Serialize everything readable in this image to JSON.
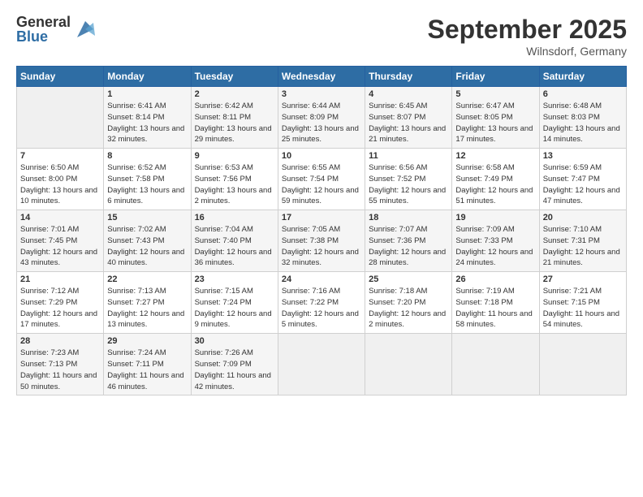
{
  "logo": {
    "general": "General",
    "blue": "Blue"
  },
  "header": {
    "month": "September 2025",
    "location": "Wilnsdorf, Germany"
  },
  "days_of_week": [
    "Sunday",
    "Monday",
    "Tuesday",
    "Wednesday",
    "Thursday",
    "Friday",
    "Saturday"
  ],
  "weeks": [
    [
      {
        "day": "",
        "sunrise": "",
        "sunset": "",
        "daylight": ""
      },
      {
        "day": "1",
        "sunrise": "Sunrise: 6:41 AM",
        "sunset": "Sunset: 8:14 PM",
        "daylight": "Daylight: 13 hours and 32 minutes."
      },
      {
        "day": "2",
        "sunrise": "Sunrise: 6:42 AM",
        "sunset": "Sunset: 8:11 PM",
        "daylight": "Daylight: 13 hours and 29 minutes."
      },
      {
        "day": "3",
        "sunrise": "Sunrise: 6:44 AM",
        "sunset": "Sunset: 8:09 PM",
        "daylight": "Daylight: 13 hours and 25 minutes."
      },
      {
        "day": "4",
        "sunrise": "Sunrise: 6:45 AM",
        "sunset": "Sunset: 8:07 PM",
        "daylight": "Daylight: 13 hours and 21 minutes."
      },
      {
        "day": "5",
        "sunrise": "Sunrise: 6:47 AM",
        "sunset": "Sunset: 8:05 PM",
        "daylight": "Daylight: 13 hours and 17 minutes."
      },
      {
        "day": "6",
        "sunrise": "Sunrise: 6:48 AM",
        "sunset": "Sunset: 8:03 PM",
        "daylight": "Daylight: 13 hours and 14 minutes."
      }
    ],
    [
      {
        "day": "7",
        "sunrise": "Sunrise: 6:50 AM",
        "sunset": "Sunset: 8:00 PM",
        "daylight": "Daylight: 13 hours and 10 minutes."
      },
      {
        "day": "8",
        "sunrise": "Sunrise: 6:52 AM",
        "sunset": "Sunset: 7:58 PM",
        "daylight": "Daylight: 13 hours and 6 minutes."
      },
      {
        "day": "9",
        "sunrise": "Sunrise: 6:53 AM",
        "sunset": "Sunset: 7:56 PM",
        "daylight": "Daylight: 13 hours and 2 minutes."
      },
      {
        "day": "10",
        "sunrise": "Sunrise: 6:55 AM",
        "sunset": "Sunset: 7:54 PM",
        "daylight": "Daylight: 12 hours and 59 minutes."
      },
      {
        "day": "11",
        "sunrise": "Sunrise: 6:56 AM",
        "sunset": "Sunset: 7:52 PM",
        "daylight": "Daylight: 12 hours and 55 minutes."
      },
      {
        "day": "12",
        "sunrise": "Sunrise: 6:58 AM",
        "sunset": "Sunset: 7:49 PM",
        "daylight": "Daylight: 12 hours and 51 minutes."
      },
      {
        "day": "13",
        "sunrise": "Sunrise: 6:59 AM",
        "sunset": "Sunset: 7:47 PM",
        "daylight": "Daylight: 12 hours and 47 minutes."
      }
    ],
    [
      {
        "day": "14",
        "sunrise": "Sunrise: 7:01 AM",
        "sunset": "Sunset: 7:45 PM",
        "daylight": "Daylight: 12 hours and 43 minutes."
      },
      {
        "day": "15",
        "sunrise": "Sunrise: 7:02 AM",
        "sunset": "Sunset: 7:43 PM",
        "daylight": "Daylight: 12 hours and 40 minutes."
      },
      {
        "day": "16",
        "sunrise": "Sunrise: 7:04 AM",
        "sunset": "Sunset: 7:40 PM",
        "daylight": "Daylight: 12 hours and 36 minutes."
      },
      {
        "day": "17",
        "sunrise": "Sunrise: 7:05 AM",
        "sunset": "Sunset: 7:38 PM",
        "daylight": "Daylight: 12 hours and 32 minutes."
      },
      {
        "day": "18",
        "sunrise": "Sunrise: 7:07 AM",
        "sunset": "Sunset: 7:36 PM",
        "daylight": "Daylight: 12 hours and 28 minutes."
      },
      {
        "day": "19",
        "sunrise": "Sunrise: 7:09 AM",
        "sunset": "Sunset: 7:33 PM",
        "daylight": "Daylight: 12 hours and 24 minutes."
      },
      {
        "day": "20",
        "sunrise": "Sunrise: 7:10 AM",
        "sunset": "Sunset: 7:31 PM",
        "daylight": "Daylight: 12 hours and 21 minutes."
      }
    ],
    [
      {
        "day": "21",
        "sunrise": "Sunrise: 7:12 AM",
        "sunset": "Sunset: 7:29 PM",
        "daylight": "Daylight: 12 hours and 17 minutes."
      },
      {
        "day": "22",
        "sunrise": "Sunrise: 7:13 AM",
        "sunset": "Sunset: 7:27 PM",
        "daylight": "Daylight: 12 hours and 13 minutes."
      },
      {
        "day": "23",
        "sunrise": "Sunrise: 7:15 AM",
        "sunset": "Sunset: 7:24 PM",
        "daylight": "Daylight: 12 hours and 9 minutes."
      },
      {
        "day": "24",
        "sunrise": "Sunrise: 7:16 AM",
        "sunset": "Sunset: 7:22 PM",
        "daylight": "Daylight: 12 hours and 5 minutes."
      },
      {
        "day": "25",
        "sunrise": "Sunrise: 7:18 AM",
        "sunset": "Sunset: 7:20 PM",
        "daylight": "Daylight: 12 hours and 2 minutes."
      },
      {
        "day": "26",
        "sunrise": "Sunrise: 7:19 AM",
        "sunset": "Sunset: 7:18 PM",
        "daylight": "Daylight: 11 hours and 58 minutes."
      },
      {
        "day": "27",
        "sunrise": "Sunrise: 7:21 AM",
        "sunset": "Sunset: 7:15 PM",
        "daylight": "Daylight: 11 hours and 54 minutes."
      }
    ],
    [
      {
        "day": "28",
        "sunrise": "Sunrise: 7:23 AM",
        "sunset": "Sunset: 7:13 PM",
        "daylight": "Daylight: 11 hours and 50 minutes."
      },
      {
        "day": "29",
        "sunrise": "Sunrise: 7:24 AM",
        "sunset": "Sunset: 7:11 PM",
        "daylight": "Daylight: 11 hours and 46 minutes."
      },
      {
        "day": "30",
        "sunrise": "Sunrise: 7:26 AM",
        "sunset": "Sunset: 7:09 PM",
        "daylight": "Daylight: 11 hours and 42 minutes."
      },
      {
        "day": "",
        "sunrise": "",
        "sunset": "",
        "daylight": ""
      },
      {
        "day": "",
        "sunrise": "",
        "sunset": "",
        "daylight": ""
      },
      {
        "day": "",
        "sunrise": "",
        "sunset": "",
        "daylight": ""
      },
      {
        "day": "",
        "sunrise": "",
        "sunset": "",
        "daylight": ""
      }
    ]
  ]
}
